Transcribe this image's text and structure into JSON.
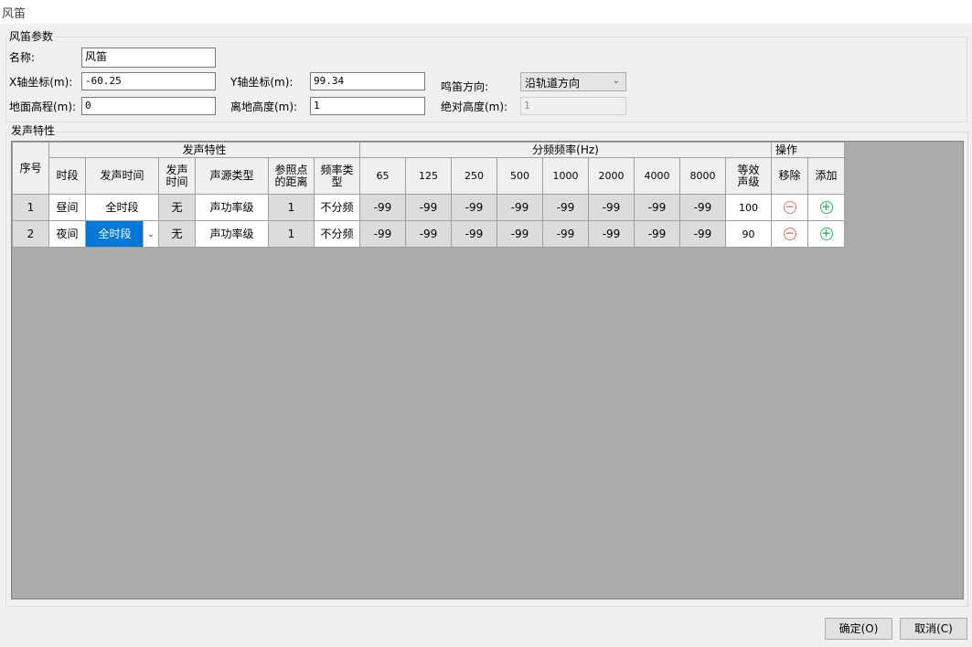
{
  "window": {
    "title": "风笛"
  },
  "params": {
    "legend": "风笛参数",
    "name_label": "名称:",
    "name_value": "风笛",
    "x_label": "X轴坐标(m):",
    "x_value": "-60.25",
    "y_label": "Y轴坐标(m):",
    "y_value": "99.34",
    "direction_label": "鸣笛方向:",
    "direction_value": "沿轨道方向",
    "ground_label": "地面高程(m):",
    "ground_value": "0",
    "height_label": "离地高度(m):",
    "height_value": "1",
    "abs_height_label": "绝对高度(m):",
    "abs_height_value": "1"
  },
  "sound": {
    "legend": "发声特性",
    "group_headers": {
      "characteristics": "发声特性",
      "frequency": "分频频率(Hz)",
      "ops": "操作"
    },
    "columns": {
      "index": "序号",
      "period": "时段",
      "emit_time": "发声时间",
      "emit_time2": "发声时间",
      "source_type": "声源类型",
      "ref_dist": "参照点的距离",
      "freq_type": "频率类型",
      "freqs": [
        "65",
        "125",
        "250",
        "500",
        "1000",
        "2000",
        "4000",
        "8000"
      ],
      "level": "等效声级",
      "remove": "移除",
      "add": "添加"
    },
    "rows": [
      {
        "index": "1",
        "period": "昼间",
        "emit_time": "全时段",
        "emit_flag": "无",
        "source_type": "声功率级",
        "ref_dist": "1",
        "freq_type": "不分频",
        "f65": "-99",
        "f125": "-99",
        "f250": "-99",
        "f500": "-99",
        "f1000": "-99",
        "f2000": "-99",
        "f4000": "-99",
        "f8000": "-99",
        "level": "100"
      },
      {
        "index": "2",
        "period": "夜间",
        "emit_time": "全时段",
        "emit_flag": "无",
        "source_type": "声功率级",
        "ref_dist": "1",
        "freq_type": "不分频",
        "f65": "-99",
        "f125": "-99",
        "f250": "-99",
        "f500": "-99",
        "f1000": "-99",
        "f2000": "-99",
        "f4000": "-99",
        "f8000": "-99",
        "level": "90"
      }
    ]
  },
  "buttons": {
    "ok": "确定(O)",
    "cancel": "取消(C)"
  },
  "colors": {
    "selection": "#0078d7",
    "remove_icon": "#e57373",
    "add_icon": "#2fb86f",
    "grid_bg": "#ababab"
  }
}
